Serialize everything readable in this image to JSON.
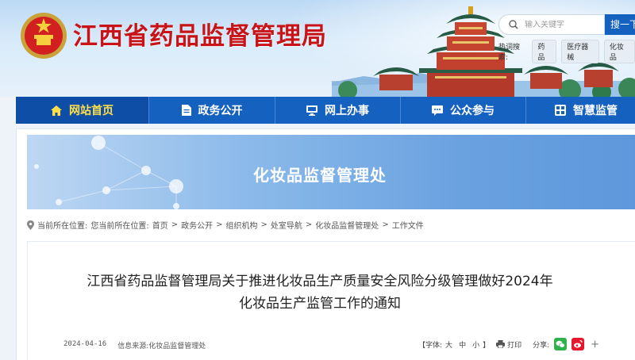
{
  "header": {
    "site_title": "江西省药品监督管理局",
    "search_placeholder": "输入关键字",
    "search_button": "搜一下",
    "hot_label": "热词搜索:",
    "hot_tags": [
      "药品",
      "医疗器械",
      "化妆品"
    ]
  },
  "nav": {
    "items": [
      {
        "label": "网站首页",
        "icon": "home-icon",
        "active": true
      },
      {
        "label": "政务公开",
        "icon": "document-icon",
        "active": false
      },
      {
        "label": "网上办事",
        "icon": "monitor-icon",
        "active": false
      },
      {
        "label": "公众参与",
        "icon": "chat-icon",
        "active": false
      },
      {
        "label": "智慧监管",
        "icon": "grid-icon",
        "active": false
      }
    ],
    "colors": {
      "bar": "#1561c0",
      "active_bg": "#0e4ea6",
      "active_text": "#ffe04a"
    }
  },
  "banner": {
    "title": "化妆品监督管理处"
  },
  "breadcrumb": {
    "prefix": "当前所在位置:",
    "prefix2": "您当前所在位置:",
    "items": [
      "首页",
      "政务公开",
      "组织机构",
      "处室导航",
      "化妆品监督管理处",
      "工作文件"
    ],
    "separator": ">"
  },
  "article": {
    "title_line1": "江西省药品监督管理局关于推进化妆品生产质量安全风险分级管理做好2024年",
    "title_line2": "化妆品生产监管工作的通知",
    "date": "2024-04-16",
    "source_label": "信息来源:",
    "source": "化妆品监督管理处",
    "font_label": "【字体:",
    "font_large": "大",
    "font_medium": "中",
    "font_small": "小",
    "font_close": "】",
    "print": "打印",
    "share_label": "分享:",
    "share_more": "+"
  }
}
